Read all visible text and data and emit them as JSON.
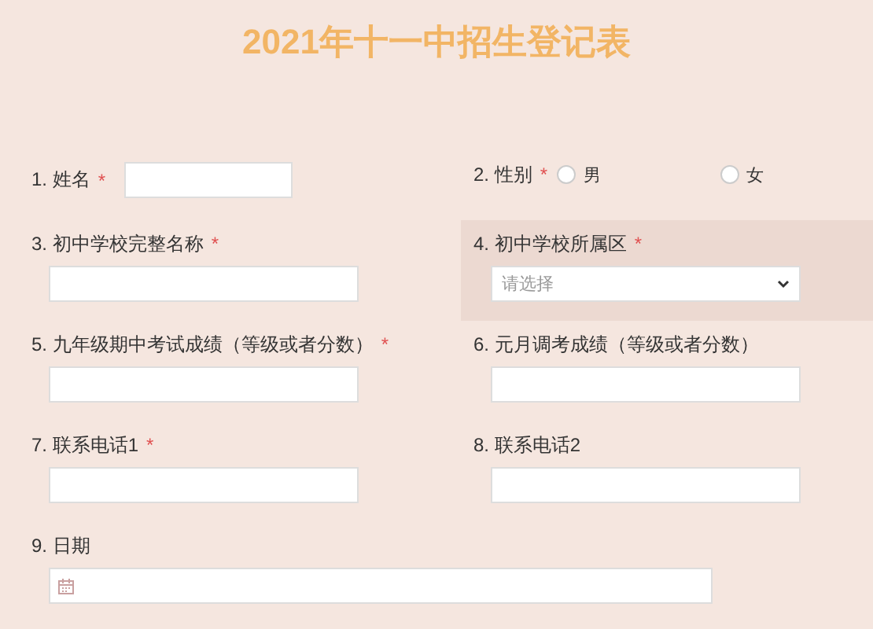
{
  "title": "2021年十一中招生登记表",
  "questions": [
    {
      "kind": "inline-text",
      "label": "1. 姓名",
      "required_mark": "*",
      "highlighted": false
    },
    {
      "kind": "radio",
      "label": "2. 性别",
      "required_mark": "*",
      "highlighted": false,
      "options": [
        {
          "label": "男",
          "selected": false
        },
        {
          "label": "女",
          "selected": false
        }
      ]
    },
    {
      "kind": "text",
      "label": "3. 初中学校完整名称",
      "required_mark": "*",
      "highlighted": false
    },
    {
      "kind": "select",
      "label": "4. 初中学校所属区",
      "required_mark": "*",
      "highlighted": true,
      "placeholder": "请选择"
    },
    {
      "kind": "text",
      "label": "5. 九年级期中考试成绩（等级或者分数）",
      "required_mark": "*",
      "highlighted": false
    },
    {
      "kind": "text",
      "label": "6. 元月调考成绩（等级或者分数）",
      "highlighted": false
    },
    {
      "kind": "text",
      "label": "7. 联系电话1",
      "required_mark": "*",
      "highlighted": false
    },
    {
      "kind": "text",
      "label": "8. 联系电话2",
      "highlighted": false
    },
    {
      "kind": "date",
      "label": "9. 日期",
      "highlighted": false
    }
  ]
}
